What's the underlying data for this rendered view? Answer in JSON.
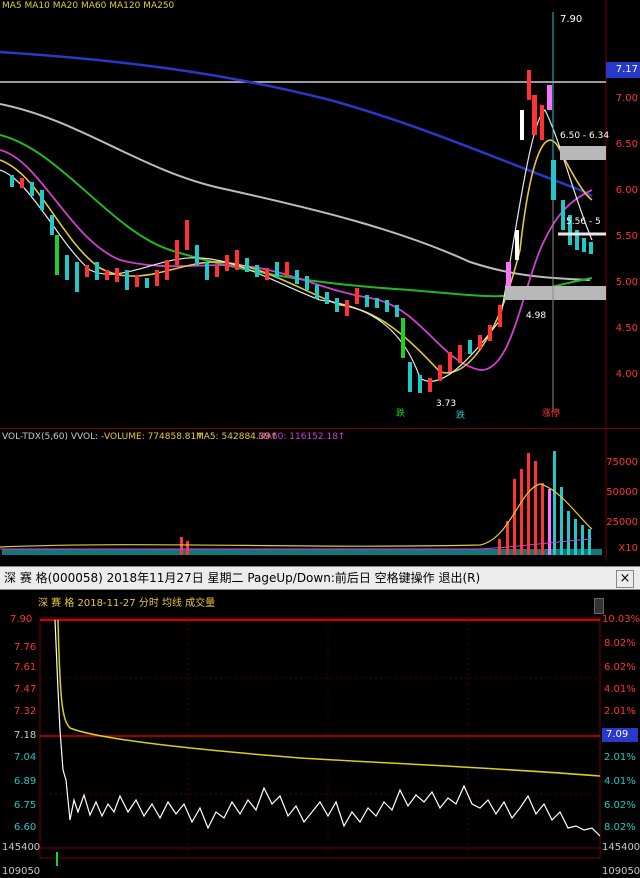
{
  "top_panel": {
    "header_text": "MA5  MA10  MA20  MA60  MA120  MA250",
    "price_labels": [
      "7.17",
      "7.00",
      "6.50",
      "6.00",
      "5.50",
      "5.00",
      "4.50",
      "4.00"
    ],
    "highlight_price": "7.17",
    "annotations": {
      "high": "7.90",
      "mid1": "6.50 - 6.34",
      "mid2": "5.56 - 5",
      "low_mark": "4.98",
      "bottom": "3.73"
    },
    "markers": [
      "跌",
      "跌",
      "涨停"
    ]
  },
  "volume_panel": {
    "legend": {
      "name": "VOL-TDX(5,60) VVOL: -",
      "volume": "VOLUME: 774858.81↑",
      "ma5": "MA5: 542884.39↑",
      "ma60": "MA60: 116152.18↑"
    },
    "axis_labels": [
      "75000",
      "50000",
      "25000",
      "X10"
    ]
  },
  "window": {
    "title": "深 赛 格(000058) 2018年11月27日 星期二 PageUp/Down:前后日 空格键操作 退出(R)",
    "close_label": "×"
  },
  "intraday_panel": {
    "header": "深 赛 格   2018-11-27 分时 均线 成交量",
    "left_labels": [
      "7.90",
      "7.76",
      "7.61",
      "7.47",
      "7.32",
      "7.18",
      "7.04",
      "6.89",
      "6.75",
      "6.60",
      "145400"
    ],
    "right_labels": [
      "10.03%",
      "8.02%",
      "6.02%",
      "4.01%",
      "2.01%",
      "7.09",
      "2.01%",
      "4.01%",
      "6.02%",
      "8.02%",
      "145400"
    ],
    "bottom_left": "109050",
    "bottom_right": "109050"
  },
  "colors": {
    "up": "#ff3333",
    "down": "#22c7c7",
    "ma5": "#e8e8e8",
    "ma10": "#e6c83a",
    "ma20": "#d040d0",
    "ma60": "#22b822",
    "ma120": "#bdbdbd",
    "ma250": "#2838c8",
    "avg_line": "#d8d01c",
    "price_line": "#ffffff",
    "grid_red": "#7a0000"
  }
}
